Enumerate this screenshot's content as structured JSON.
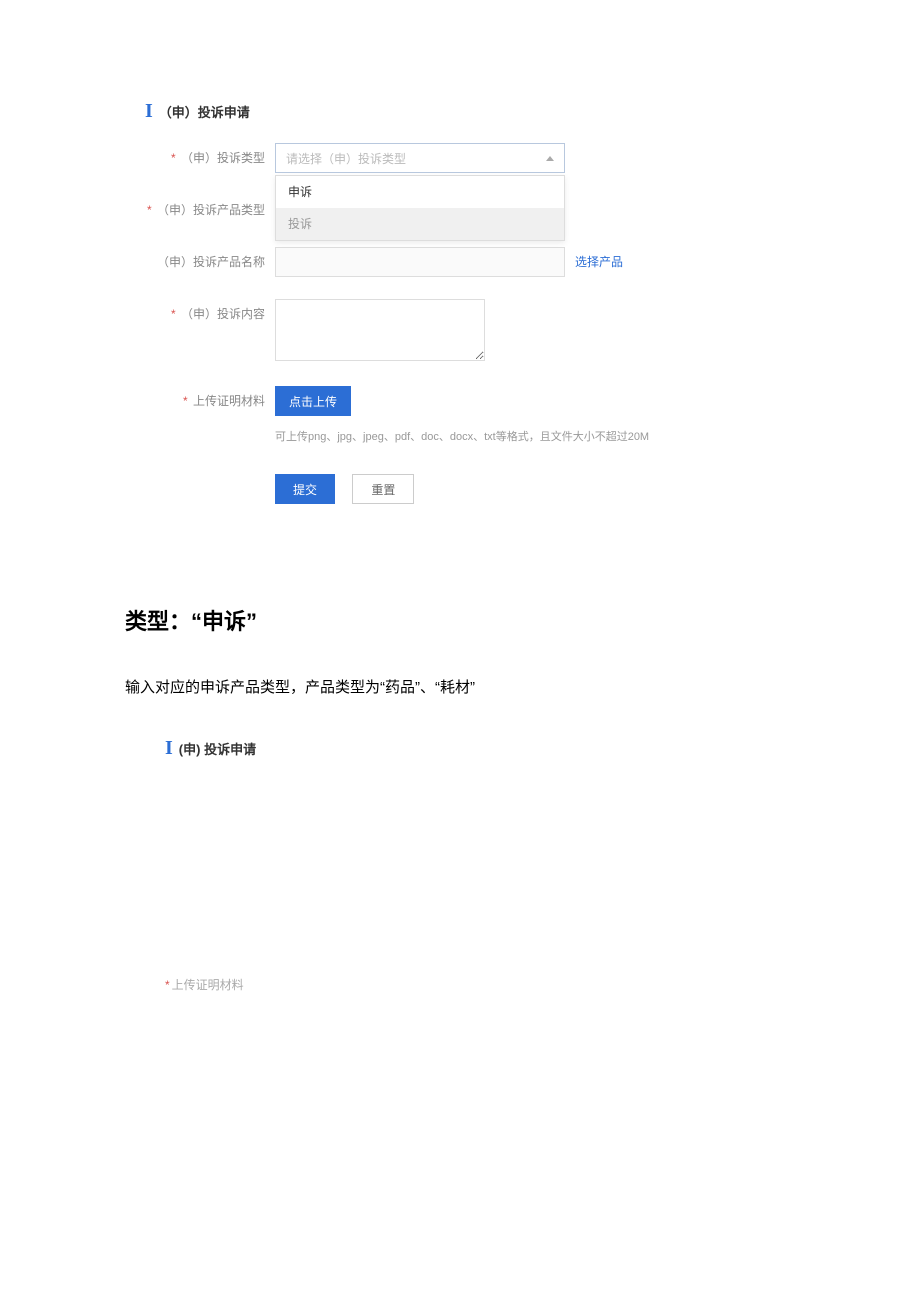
{
  "form1": {
    "title_mark": "I",
    "title": "（申）投诉申请",
    "rows": {
      "type": {
        "label": "（申）投诉类型",
        "placeholder": "请选择（申）投诉类型",
        "options": [
          "申诉",
          "投诉"
        ]
      },
      "product_type": {
        "label": "（申）投诉产品类型"
      },
      "product_name": {
        "label": "（申）投诉产品名称",
        "link": "选择产品"
      },
      "content": {
        "label": "（申）投诉内容"
      },
      "upload": {
        "label": "上传证明材料",
        "button": "点击上传",
        "hint": "可上传png、jpg、jpeg、pdf、doc、docx、txt等格式，且文件大小不超过20M"
      }
    },
    "submit": "提交",
    "reset": "重置"
  },
  "doc": {
    "heading": "类型：“申诉”",
    "paragraph": "输入对应的申诉产品类型，产品类型为“药品”、“耗材”"
  },
  "form2": {
    "title_mark": "I",
    "title": "(申) 投诉申请",
    "upload_label": "上传证明材料"
  }
}
